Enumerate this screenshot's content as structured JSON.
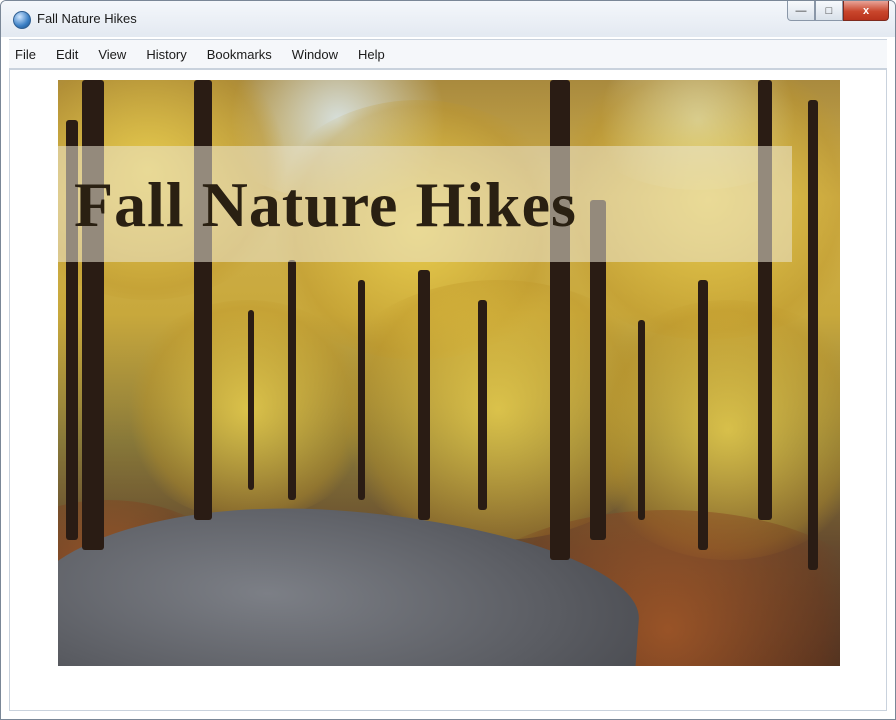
{
  "window": {
    "title": "Fall Nature Hikes",
    "controls": {
      "minimize": "—",
      "maximize": "□",
      "close": "x"
    }
  },
  "menu": {
    "items": [
      "File",
      "Edit",
      "View",
      "History",
      "Bookmarks",
      "Window",
      "Help"
    ]
  },
  "page": {
    "heading": "Fall Nature Hikes"
  }
}
